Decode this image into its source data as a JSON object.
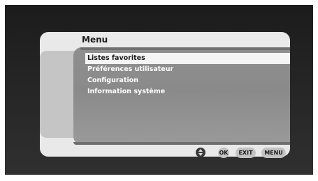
{
  "menu": {
    "title": "Menu",
    "items": [
      {
        "label": "Listes favorites",
        "selected": true
      },
      {
        "label": "Préférences utilisateur",
        "selected": false
      },
      {
        "label": "Configuration",
        "selected": false
      },
      {
        "label": "Information système",
        "selected": false
      }
    ]
  },
  "buttons": {
    "nav_icon": "up-down-arrows-icon",
    "ok_label": "OK",
    "exit_label": "EXIT",
    "menu_label": "MENU"
  },
  "colors": {
    "background": "#262626",
    "panel": "#e9e9e9",
    "content": "#8f8f8f",
    "selection": "#f4f4f4"
  }
}
